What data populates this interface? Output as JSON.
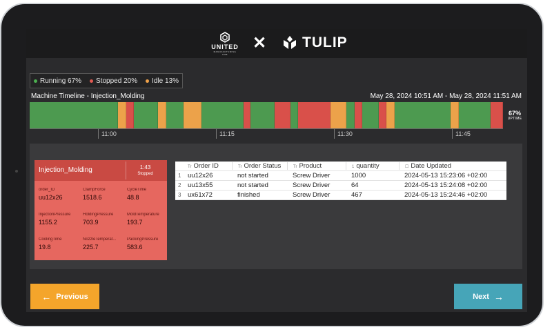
{
  "header": {
    "brand_left": "UNITED",
    "brand_left_sub": "MANUFACTURING HUB",
    "separator": "✕",
    "brand_right": "TULIP"
  },
  "legend": [
    {
      "label": "Running 67%",
      "color": "#4caf50"
    },
    {
      "label": "Stopped 20%",
      "color": "#e05a52"
    },
    {
      "label": "Idle 13%",
      "color": "#f0a24a"
    }
  ],
  "timeline": {
    "title": "Machine Timeline - Injection_Molding",
    "range": "May 28, 2024 10:51 AM - May 28, 2024 11:51 AM",
    "uptime_pct": "67%",
    "uptime_label": "UPTIME",
    "ticks": [
      "11:00",
      "11:15",
      "11:30",
      "11:45"
    ],
    "colors": {
      "running": "#4d9a50",
      "stopped": "#d9504a",
      "idle": "#eca24a"
    },
    "segments": [
      {
        "state": "running",
        "minutes": 11.0
      },
      {
        "state": "idle",
        "minutes": 1.0
      },
      {
        "state": "stopped",
        "minutes": 1.0
      },
      {
        "state": "running",
        "minutes": 3.0
      },
      {
        "state": "idle",
        "minutes": 1.0
      },
      {
        "state": "running",
        "minutes": 2.2
      },
      {
        "state": "idle",
        "minutes": 2.2
      },
      {
        "state": "running",
        "minutes": 5.3
      },
      {
        "state": "stopped",
        "minutes": 0.8
      },
      {
        "state": "running",
        "minutes": 3.0
      },
      {
        "state": "stopped",
        "minutes": 2.0
      },
      {
        "state": "running",
        "minutes": 1.0
      },
      {
        "state": "stopped",
        "minutes": 4.0
      },
      {
        "state": "idle",
        "minutes": 2.0
      },
      {
        "state": "running",
        "minutes": 1.0
      },
      {
        "state": "stopped",
        "minutes": 1.0
      },
      {
        "state": "running",
        "minutes": 2.0
      },
      {
        "state": "stopped",
        "minutes": 1.0
      },
      {
        "state": "idle",
        "minutes": 1.0
      },
      {
        "state": "running",
        "minutes": 7.0
      },
      {
        "state": "idle",
        "minutes": 1.0
      },
      {
        "state": "running",
        "minutes": 4.0
      },
      {
        "state": "stopped",
        "minutes": 1.5
      }
    ]
  },
  "card": {
    "title": "Injection_Molding",
    "timer": "1:43",
    "status": "Stopped",
    "metrics": [
      {
        "key": "order_ID",
        "value": "uu12x26"
      },
      {
        "key": "ClampForce",
        "value": "1518.6"
      },
      {
        "key": "CycleTime",
        "value": "48.8"
      },
      {
        "key": "InjectionPressure",
        "value": "1155.2"
      },
      {
        "key": "HoldingPressure",
        "value": "703.9"
      },
      {
        "key": "MoldTemperature",
        "value": "193.7"
      },
      {
        "key": "CoolingTime",
        "value": "19.8"
      },
      {
        "key": "NozzleTemperat...",
        "value": "225.7"
      },
      {
        "key": "PackingPressure",
        "value": "583.6"
      }
    ]
  },
  "table": {
    "headers": {
      "order_id": "Order ID",
      "status": "Order Status",
      "product": "Product",
      "quantity": "quantity",
      "date": "Date Updated"
    },
    "header_icons": {
      "text": "Tr",
      "number": "1",
      "date": "☐"
    },
    "rows": [
      {
        "n": "1",
        "order_id": "uu12x26",
        "status": "not started",
        "product": "Screw Driver",
        "quantity": "1000",
        "date": "2024-05-13 15:23:06 +02:00"
      },
      {
        "n": "2",
        "order_id": "uu13x55",
        "status": "not started",
        "product": "Screw Driver",
        "quantity": "64",
        "date": "2024-05-13 15:24:08 +02:00"
      },
      {
        "n": "3",
        "order_id": "ux61x72",
        "status": "finished",
        "product": "Screw Driver",
        "quantity": "467",
        "date": "2024-05-13 15:24:46 +02:00"
      }
    ]
  },
  "buttons": {
    "previous": "Previous",
    "next": "Next",
    "prev_icon": "←",
    "next_icon": "→"
  }
}
